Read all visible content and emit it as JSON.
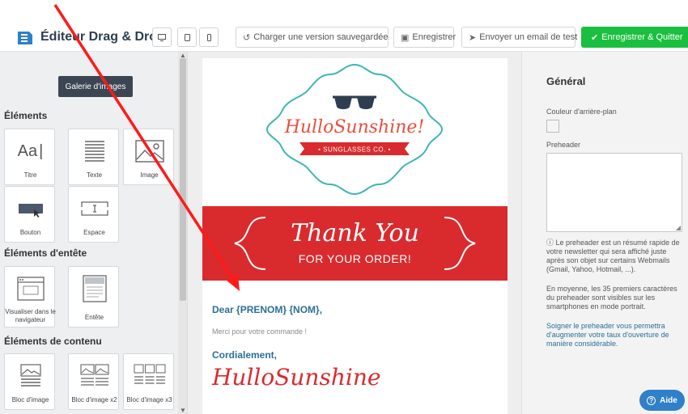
{
  "header": {
    "app_title": "Éditeur Drag & Drop",
    "load_version_label": "Charger une version sauvegardée",
    "save_label": "Enregistrer",
    "send_test_label": "Envoyer un email de test",
    "save_quit_label": "Enregistrer & Quitter",
    "accent_green": "#1bbf3f",
    "icons": [
      "desktop-icon",
      "tablet-icon",
      "mobile-icon",
      "history-icon",
      "floppy-icon",
      "paper-plane-icon",
      "check-icon"
    ]
  },
  "left_panel": {
    "gallery_button": "Galerie d'images",
    "sections": {
      "elements": {
        "title": "Éléments",
        "tiles": [
          {
            "label": "Titre",
            "icon": "text-aa-icon"
          },
          {
            "label": "Texte",
            "icon": "paragraph-lines-icon"
          },
          {
            "label": "Image",
            "icon": "image-icon"
          },
          {
            "label": "Bouton",
            "icon": "button-icon"
          },
          {
            "label": "Espace",
            "icon": "spacer-icon"
          }
        ]
      },
      "header_elements": {
        "title": "Éléments d'entête",
        "tiles": [
          {
            "label": "Visualiser dans le navigateur",
            "icon": "browser-view-icon"
          },
          {
            "label": "Entête",
            "icon": "header-icon"
          }
        ]
      },
      "content_elements": {
        "title": "Éléments de contenu",
        "tiles": [
          {
            "label": "Bloc d'image",
            "icon": "image-block-icon"
          },
          {
            "label": "Bloc d'image x2",
            "icon": "image-block-x2-icon"
          },
          {
            "label": "Bloc d'image x3",
            "icon": "image-block-x3-icon"
          }
        ]
      }
    }
  },
  "email": {
    "logo_name": "HulloSunshine!",
    "logo_ribbon": "• SUNGLASSES CO. •",
    "banner_title": "Thank You",
    "banner_subtitle": "FOR YOUR ORDER!",
    "greeting": "Dear {PRENOM} {NOM},",
    "body": "Merci pour votre commande !",
    "closing": "Cordialement,",
    "signature": "HulloSunshine",
    "banner_color": "#d92b2e",
    "text_blue": "#2a6f96"
  },
  "right_panel": {
    "title": "Général",
    "bg_color_label": "Couleur d'arrière-plan",
    "preheader_label": "Preheader",
    "info_1": "Le preheader est un résumé rapide de votre newsletter qui sera affiché juste après son objet sur certains Webmails (Gmail, Yahoo, Hotmail, ...).",
    "info_2": "En moyenne, les 35 premiers caractères du preheader sont visibles sur les smartphones en mode portrait.",
    "info_3": "Soigner le preheader vous permettra d'augmenter votre taux d'ouverture de manière considérable."
  },
  "help_button": "Aide"
}
